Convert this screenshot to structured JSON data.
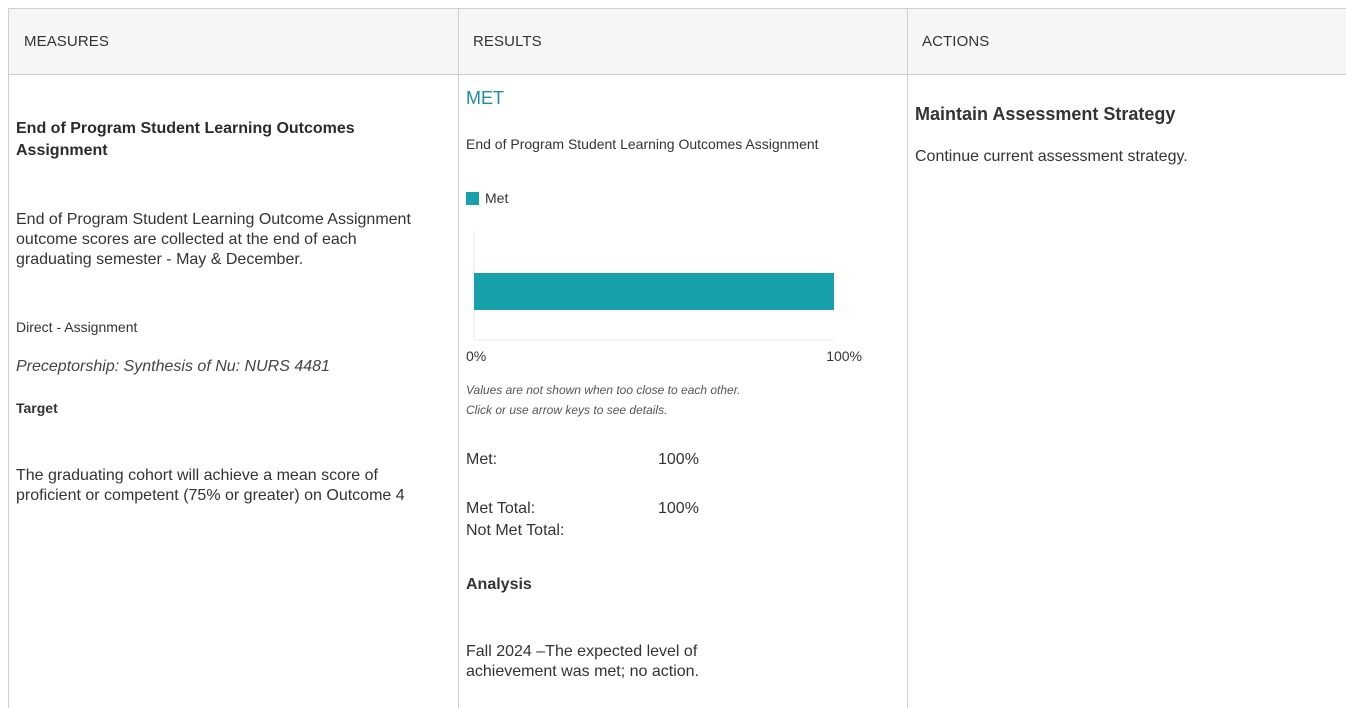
{
  "headers": {
    "measures": "MEASURES",
    "results": "RESULTS",
    "actions": "ACTIONS"
  },
  "measure": {
    "title": "End of Program Student Learning Outcomes Assignment",
    "description": "End of Program Student Learning Outcome Assignment outcome scores are collected at the end of each graduating semester - May & December.",
    "method": "Direct - Assignment",
    "course": "Preceptorship: Synthesis of Nu: NURS 4481",
    "target_label": "Target",
    "target": "The graduating cohort will achieve a mean score of proficient or competent (75% or greater) on Outcome 4"
  },
  "results": {
    "status": "MET",
    "status_color": "#1a8ea0",
    "chart_title": "End of Program Student Learning Outcomes Assignment",
    "note_line1": "Values are not shown when too close to each other.",
    "note_line2": "Click or use arrow keys to see details.",
    "met_label": "Met:",
    "met_value": "100%",
    "met_total_label": "Met Total:",
    "met_total_value": "100%",
    "not_met_total_label": "Not Met Total:",
    "analysis_label": "Analysis",
    "analysis_text": "Fall 2024 –The expected level of achievement was met; no action."
  },
  "chart_data": {
    "type": "bar",
    "orientation": "horizontal",
    "categories": [
      ""
    ],
    "series": [
      {
        "name": "Met",
        "values": [
          100
        ],
        "color": "#17a2aa"
      }
    ],
    "xlim": [
      0,
      100
    ],
    "x_tick_labels": [
      "0%",
      "100%"
    ],
    "legend": "top-left",
    "grid": false
  },
  "action": {
    "title": "Maintain Assessment Strategy",
    "text": "Continue current assessment strategy."
  }
}
